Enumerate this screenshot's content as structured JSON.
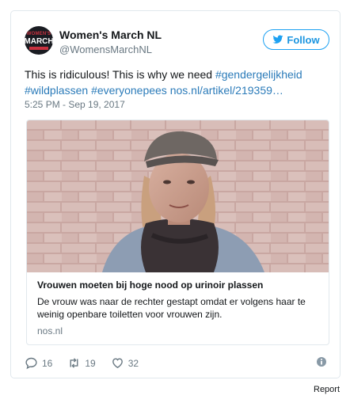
{
  "tweet": {
    "author_name": "Women's March NL",
    "author_handle": "@WomensMarchNL",
    "avatar_text_top": "WOMEN'S",
    "avatar_text_main": "MARCH",
    "follow_label": "Follow",
    "text_plain": "This is ridiculous! This is why we need ",
    "hashtag_1": "#gendergelijkheid",
    "hashtag_2": "#wildplassen",
    "hashtag_3": "#everyonepees",
    "link": "nos.nl/artikel/219359…",
    "timestamp": "5:25 PM - Sep 19, 2017"
  },
  "embed": {
    "title": "Vrouwen moeten bij hoge nood op urinoir plassen",
    "description": "De vrouw was naar de rechter gestapt omdat er volgens haar te weinig openbare toiletten voor vrouwen zijn.",
    "domain": "nos.nl"
  },
  "actions": {
    "replies": "16",
    "retweets": "19",
    "likes": "32"
  },
  "footer": {
    "report_label": "Report"
  },
  "colors": {
    "accent": "#1da1f2",
    "link": "#2b7bb9",
    "muted": "#697882"
  }
}
